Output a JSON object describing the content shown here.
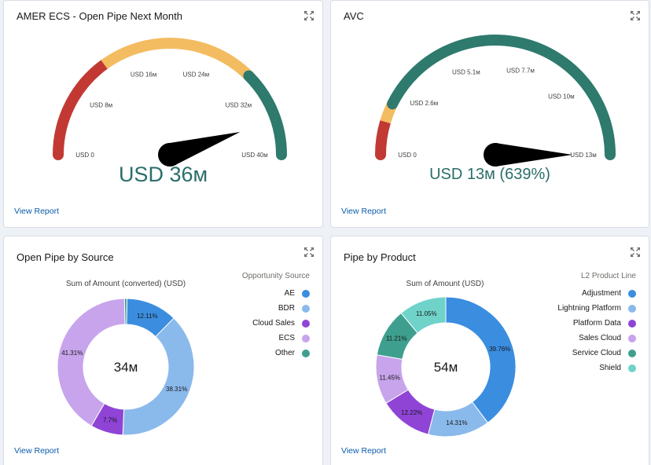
{
  "icons": {
    "expand": "expand-icon"
  },
  "link_label": "View Report",
  "chart_data": [
    {
      "type": "gauge",
      "title": "AMER ECS - Open Pipe Next Month",
      "min": 0,
      "max": 40,
      "value": 36,
      "value_label": "USD 36м",
      "ticks": [
        {
          "value": 0,
          "label": "USD 0"
        },
        {
          "value": 8,
          "label": "USD 8м"
        },
        {
          "value": 16,
          "label": "USD 16м"
        },
        {
          "value": 24,
          "label": "USD 24м"
        },
        {
          "value": 32,
          "label": "USD 32м"
        },
        {
          "value": 40,
          "label": "USD 40м"
        }
      ],
      "bands": [
        {
          "from": 0,
          "to": 12,
          "color": "#c23934"
        },
        {
          "from": 12,
          "to": 30,
          "color": "#f3bc61"
        },
        {
          "from": 30,
          "to": 40,
          "color": "#2e7a6d"
        }
      ]
    },
    {
      "type": "gauge",
      "title": "AVC",
      "min": 0,
      "max": 13,
      "value": 13,
      "value_label": "USD 13м (639%)",
      "ticks": [
        {
          "value": 0,
          "label": "USD 0"
        },
        {
          "value": 2.6,
          "label": "USD 2.6м"
        },
        {
          "value": 5.1,
          "label": "USD 5.1м"
        },
        {
          "value": 7.7,
          "label": "USD 7.7м"
        },
        {
          "value": 10,
          "label": "USD 10м"
        },
        {
          "value": 13,
          "label": "USD 13м"
        }
      ],
      "bands": [
        {
          "from": 0,
          "to": 1.2,
          "color": "#c23934"
        },
        {
          "from": 1.2,
          "to": 1.9,
          "color": "#f3bc61"
        },
        {
          "from": 1.9,
          "to": 13,
          "color": "#2e7a6d"
        }
      ]
    },
    {
      "type": "donut",
      "title": "Open Pipe by Source",
      "subtitle": "Sum of Amount (converted) (USD)",
      "center_label": "34м",
      "legend_title": "Opportunity Source",
      "legend_position": "right",
      "slices": [
        {
          "name": "AE",
          "value": 12.11,
          "label": "12.11%",
          "color": "#3b8de0"
        },
        {
          "name": "BDR",
          "value": 38.31,
          "label": "38.31%",
          "color": "#8ab9ec"
        },
        {
          "name": "Cloud Sales",
          "value": 7.7,
          "label": "7.7%",
          "color": "#8f44d6"
        },
        {
          "name": "ECS",
          "value": 41.31,
          "label": "41.31%",
          "color": "#c7a4ec"
        },
        {
          "name": "Other",
          "value": 0.57,
          "label": "",
          "color": "#3f9f8f"
        }
      ]
    },
    {
      "type": "donut",
      "title": "Pipe by Product",
      "subtitle": "Sum of Amount (USD)",
      "center_label": "54м",
      "legend_title": "L2 Product Line",
      "legend_position": "right",
      "slices": [
        {
          "name": "Adjustment",
          "value": 39.76,
          "label": "39.76%",
          "color": "#3b8de0"
        },
        {
          "name": "Lightning Platform",
          "value": 14.31,
          "label": "14.31%",
          "color": "#8ab9ec"
        },
        {
          "name": "Platform Data",
          "value": 12.22,
          "label": "12.22%",
          "color": "#8f44d6"
        },
        {
          "name": "Sales Cloud",
          "value": 11.45,
          "label": "11.45%",
          "color": "#c7a4ec"
        },
        {
          "name": "Service Cloud",
          "value": 11.21,
          "label": "11.21%",
          "color": "#3f9f8f"
        },
        {
          "name": "Shield",
          "value": 11.05,
          "label": "11.05%",
          "color": "#6fd3c9"
        }
      ]
    }
  ]
}
